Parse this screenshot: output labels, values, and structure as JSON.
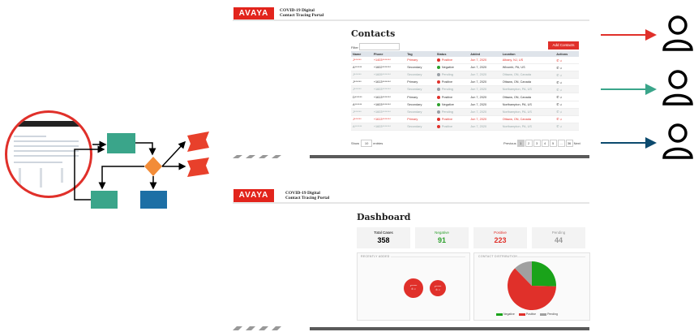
{
  "brand": {
    "logo_text": "AVAYA",
    "accent": "#e2241c"
  },
  "portal": {
    "title_line1": "COVID-19 Digital",
    "title_line2": "Contact Tracing Portal"
  },
  "contacts": {
    "title": "Contacts",
    "filter_label": "Filter",
    "add_button": "Add Contacts",
    "columns": [
      "Name",
      "Phone",
      "Tag",
      "Status",
      "Added",
      "Location",
      "Actions"
    ],
    "rows": [
      [
        "J******",
        "+1403*******",
        "Primary",
        "Positive",
        "Jun 7, 2020",
        "Albany, NJ, US"
      ],
      [
        "A******",
        "+1602*******",
        "Secondary",
        "Negative",
        "Jun 7, 2020",
        "Wixomb, PA, US"
      ],
      [
        "J******",
        "+1605*******",
        "Secondary",
        "Pending",
        "Jun 7, 2020",
        "Ottawa, ON, Canada"
      ],
      [
        "J******",
        "+1613*******",
        "Primary",
        "Positive",
        "Jun 7, 2020",
        "Ottawa, ON, Canada"
      ],
      [
        "J******",
        "+1603*******",
        "Secondary",
        "Pending",
        "Jun 7, 2020",
        "Northampton, PA, US"
      ],
      [
        "D******",
        "+1613*******",
        "Primary",
        "Positive",
        "Jun 7, 2020",
        "Ottawa, ON, Canada"
      ],
      [
        "A******",
        "+1603*******",
        "Secondary",
        "Negative",
        "Jun 7, 2020",
        "Northampton, PA, US"
      ],
      [
        "J******",
        "+1603*******",
        "Secondary",
        "Pending",
        "Jun 7, 2020",
        "Northampton, PA, US"
      ],
      [
        "J******",
        "+1613*******",
        "Primary",
        "Positive",
        "Jun 7, 2020",
        "Ottawa, ON, Canada"
      ],
      [
        "A******",
        "+1603*******",
        "Secondary",
        "Positive",
        "Jun 7, 2020",
        "Northampton, PA, US"
      ]
    ],
    "show_label": "Show",
    "show_value": "10",
    "entries_label": "entries",
    "pagination": [
      "Previous",
      "1",
      "2",
      "3",
      "4",
      "5",
      "...",
      "36",
      "Next"
    ]
  },
  "dashboard": {
    "title": "Dashboard",
    "cards": [
      {
        "label": "Total Cases",
        "value": "358",
        "color": "#222222"
      },
      {
        "label": "Negative",
        "value": "91",
        "color": "#2ca02c"
      },
      {
        "label": "Positive",
        "value": "223",
        "color": "#e0302a"
      },
      {
        "label": "Pending",
        "value": "44",
        "color": "#999999"
      }
    ],
    "recently_added_title": "RECENTLY ADDED",
    "distribution_title": "CONTACT DISTRIBUTION",
    "bubbles": [
      {
        "label": "J******"
      },
      {
        "label": "J******"
      }
    ],
    "legend": [
      "Negative",
      "Positive",
      "Pending"
    ]
  },
  "chart_data": {
    "type": "pie",
    "categories": [
      "Negative",
      "Positive",
      "Pending"
    ],
    "values": [
      91,
      223,
      44
    ],
    "colors": [
      "#1aa31a",
      "#e0302a",
      "#a0a0a0"
    ]
  },
  "icons": {
    "user": "user-icon",
    "arrow": "arrow-right-icon",
    "phone": "phone-icon",
    "bell": "bell-icon"
  }
}
